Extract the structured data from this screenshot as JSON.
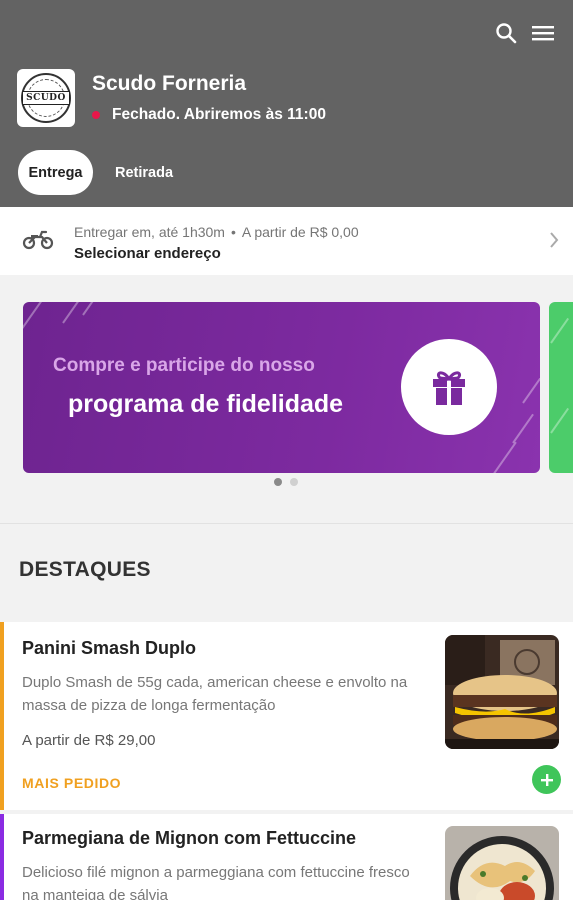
{
  "header": {
    "logo_text": "SCUDO",
    "store_name": "Scudo Forneria",
    "status": "Fechado. Abriremos às 11:00",
    "tabs": [
      {
        "label": "Entrega",
        "active": true
      },
      {
        "label": "Retirada",
        "active": false
      }
    ],
    "icons": [
      "search-icon",
      "menu-icon"
    ]
  },
  "delivery": {
    "time": "Entregar em, até 1h30m",
    "separator": "•",
    "min_order": "A partir de R$ 0,00",
    "address_label": "Selecionar endereço"
  },
  "banner": {
    "line1": "Compre e participe do nosso",
    "line2": "programa de fidelidade",
    "slides_count": 2,
    "active_slide": 1
  },
  "section": {
    "title": "DESTAQUES"
  },
  "products": [
    {
      "name": "Panini Smash Duplo",
      "description": "Duplo Smash de 55g cada, american cheese e envolto na massa de pizza de longa fermentação",
      "price": "A partir de R$ 29,00",
      "badge": "MAIS PEDIDO",
      "accent": "#f0a020"
    },
    {
      "name": "Parmegiana de Mignon com Fettuccine",
      "description": "Delicioso filé mignon a parmeggiana com fettuccine fresco na manteiga de sálvia",
      "accent": "#8a2be2"
    }
  ],
  "colors": {
    "header_bg": "#636363",
    "status_dot": "#e8174a",
    "banner_purple": "#7d2aa0",
    "add_button": "#3fc55a"
  }
}
